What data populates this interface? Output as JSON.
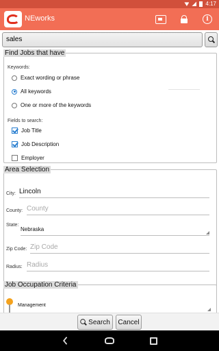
{
  "status_bar": {
    "time": "4:17"
  },
  "app": {
    "title": "NEworks"
  },
  "search": {
    "value": "sales"
  },
  "find_jobs": {
    "legend": "Find Jobs that have",
    "keywords_label": "Keywords:",
    "options": [
      {
        "label": "Exact wording or phrase",
        "selected": false
      },
      {
        "label": "All keywords",
        "selected": true
      },
      {
        "label": "One or more of the keywords",
        "selected": false
      }
    ],
    "fields_label": "Fields to search:",
    "fields": [
      {
        "label": "Job Title",
        "checked": true
      },
      {
        "label": "Job Description",
        "checked": true
      },
      {
        "label": "Employer",
        "checked": false
      }
    ]
  },
  "area": {
    "legend": "Area Selection",
    "city_label": "City:",
    "city_value": "Lincoln",
    "county_label": "County:",
    "county_placeholder": "County",
    "state_label": "State:",
    "state_value": "Nebraska",
    "zip_label": "Zip Code:",
    "zip_placeholder": "Zip Code",
    "radius_label": "Radius:",
    "radius_placeholder": "Radius"
  },
  "occupation": {
    "legend": "Job Occupation Criteria",
    "value": "Management"
  },
  "buttons": {
    "search": "Search",
    "cancel": "Cancel"
  },
  "colors": {
    "status_bar": "#d1503b",
    "action_bar": "#f26e55",
    "accent": "#2a7fd0"
  }
}
